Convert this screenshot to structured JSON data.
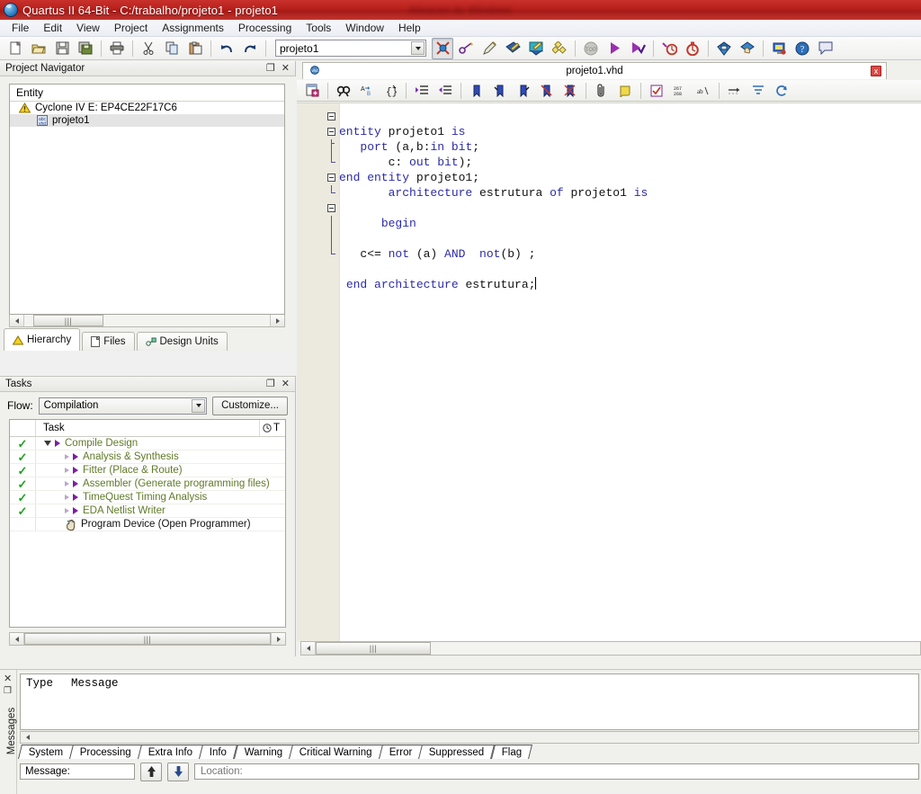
{
  "titlebar": {
    "app_title": "Quartus II 64-Bit - C:/trabalho/projeto1 - projeto1",
    "redacted_text": "Ativacao do Windows",
    "icon": "quartus-logo-icon"
  },
  "menubar": {
    "items": [
      "File",
      "Edit",
      "View",
      "Project",
      "Assignments",
      "Processing",
      "Tools",
      "Window",
      "Help"
    ]
  },
  "toolbar": {
    "project_value": "projeto1",
    "icons_left": [
      "new-file-icon",
      "open-folder-icon",
      "save-icon",
      "save-all-icon",
      "print-icon",
      "cut-icon",
      "copy-icon",
      "paste-icon",
      "undo-icon",
      "redo-icon"
    ],
    "icons_right": [
      "pin-planner-icon",
      "assignment-editor-icon",
      "pencil-icon",
      "compile-all-icon",
      "analysis-synthesis-icon",
      "netlist-viewer-icon",
      "stop-icon",
      "start-compilation-icon",
      "start-analysis-icon",
      "timing-analyzer-icon",
      "timequest-icon",
      "programmer-icon",
      "program-device-icon",
      "rtl-viewer-icon",
      "help-icon",
      "message-icon"
    ]
  },
  "navigator": {
    "title": "Project Navigator",
    "column_header": "Entity",
    "rows": [
      {
        "label": "Cyclone IV E: EP4CE22F17C6",
        "icon": "warning-triangle-icon",
        "indent": 0,
        "selected": false
      },
      {
        "label": "projeto1",
        "icon": "vhdl-file-icon",
        "indent": 1,
        "selected": true
      }
    ],
    "tabs": [
      {
        "label": "Hierarchy",
        "icon": "warning-triangle-icon",
        "active": true
      },
      {
        "label": "Files",
        "icon": "file-icon",
        "active": false
      },
      {
        "label": "Design Units",
        "icon": "design-units-icon",
        "active": false
      }
    ]
  },
  "tasks": {
    "title": "Tasks",
    "flow_label": "Flow:",
    "flow_value": "Compilation",
    "customize_label": "Customize...",
    "columns": [
      "Task",
      "T"
    ],
    "time_icon": "clock-icon",
    "rows": [
      {
        "label": "Compile Design",
        "checked": true,
        "indent": 0,
        "expander": "down",
        "arrow": "solid",
        "dark": false
      },
      {
        "label": "Analysis & Synthesis",
        "checked": true,
        "indent": 1,
        "expander": "right",
        "arrow": "solid",
        "dark": false
      },
      {
        "label": "Fitter (Place & Route)",
        "checked": true,
        "indent": 1,
        "expander": "right",
        "arrow": "solid",
        "dark": false
      },
      {
        "label": "Assembler (Generate programming files)",
        "checked": true,
        "indent": 1,
        "expander": "right",
        "arrow": "solid",
        "dark": false
      },
      {
        "label": "TimeQuest Timing Analysis",
        "checked": true,
        "indent": 1,
        "expander": "right",
        "arrow": "solid",
        "dark": false
      },
      {
        "label": "EDA Netlist Writer",
        "checked": true,
        "indent": 1,
        "expander": "right",
        "arrow": "solid",
        "dark": false
      },
      {
        "label": "Program Device (Open Programmer)",
        "checked": false,
        "indent": 0,
        "expander": "none",
        "arrow": "hand",
        "dark": true
      }
    ]
  },
  "editor": {
    "tab_title": "projeto1.vhd",
    "tab_icon": "vhdl-file-icon",
    "close_label": "x",
    "toolbar_icons": [
      "insert-template-icon",
      "find-icon",
      "find-replace-icon",
      "goto-line-icon",
      "increase-indent-icon",
      "decrease-indent-icon",
      "bookmark-add-icon",
      "bookmark-next-icon",
      "bookmark-prev-icon",
      "bookmark-clear-icon",
      "bookmark-clear-all-icon",
      "attach-icon",
      "comment-icon",
      "spellcheck-icon",
      "line-numbers-icon",
      "word-wrap-icon",
      "tab-arrow-icon",
      "align-icon",
      "reload-icon"
    ],
    "code_lines": [
      {
        "fold": "box",
        "tokens": [
          {
            "t": "entity ",
            "c": "kw"
          },
          {
            "t": "projeto1 ",
            "c": "id"
          },
          {
            "t": "is",
            "c": "kw"
          }
        ]
      },
      {
        "fold": "box",
        "tokens": [
          {
            "t": "   ",
            "c": "id"
          },
          {
            "t": "port",
            "c": "kw"
          },
          {
            "t": " (a,b:",
            "c": "id"
          },
          {
            "t": "in bit",
            "c": "kw"
          },
          {
            "t": ";",
            "c": "id"
          }
        ]
      },
      {
        "fold": "tee",
        "tokens": [
          {
            "t": "       c: ",
            "c": "id"
          },
          {
            "t": "out bit",
            "c": "kw"
          },
          {
            "t": ");",
            "c": "id"
          }
        ]
      },
      {
        "fold": "end",
        "tokens": [
          {
            "t": "end entity ",
            "c": "kw"
          },
          {
            "t": "projeto1;",
            "c": "id"
          }
        ]
      },
      {
        "fold": "box",
        "tokens": [
          {
            "t": "       ",
            "c": "id"
          },
          {
            "t": "architecture",
            "c": "kw"
          },
          {
            "t": " estrutura ",
            "c": "id"
          },
          {
            "t": "of",
            "c": "kw"
          },
          {
            "t": " projeto1 ",
            "c": "id"
          },
          {
            "t": "is",
            "c": "kw"
          }
        ]
      },
      {
        "fold": "end",
        "tokens": [
          {
            "t": "",
            "c": "id"
          }
        ]
      },
      {
        "fold": "box",
        "tokens": [
          {
            "t": "      ",
            "c": "id"
          },
          {
            "t": "begin",
            "c": "kw"
          }
        ]
      },
      {
        "fold": "line",
        "tokens": [
          {
            "t": "",
            "c": "id"
          }
        ]
      },
      {
        "fold": "line",
        "tokens": [
          {
            "t": "   c<= ",
            "c": "id"
          },
          {
            "t": "not",
            "c": "kw"
          },
          {
            "t": " (a) ",
            "c": "id"
          },
          {
            "t": "AND",
            "c": "kw"
          },
          {
            "t": "  ",
            "c": "id"
          },
          {
            "t": "not",
            "c": "kw"
          },
          {
            "t": "(b) ;",
            "c": "id"
          }
        ]
      },
      {
        "fold": "end",
        "tokens": [
          {
            "t": "",
            "c": "id"
          }
        ]
      },
      {
        "fold": "none",
        "tokens": [
          {
            "t": " ",
            "c": "id"
          },
          {
            "t": "end architecture",
            "c": "kw"
          },
          {
            "t": " estrutura;",
            "c": "id"
          }
        ],
        "caret": true
      }
    ]
  },
  "messages": {
    "panel_label": "Messages",
    "close_icon": "close-icon",
    "dock_icon": "dock-icon",
    "columns": [
      "Type",
      "Message"
    ],
    "tabs": [
      {
        "label": "System",
        "active": true
      },
      {
        "label": "Processing",
        "active": false
      },
      {
        "label": "Extra Info",
        "active": false
      },
      {
        "label": "Info",
        "active": false
      },
      {
        "label": "Warning",
        "active": false
      },
      {
        "label": "Critical Warning",
        "active": false
      },
      {
        "label": "Error",
        "active": false
      },
      {
        "label": "Suppressed",
        "active": false
      },
      {
        "label": "Flag",
        "active": false
      }
    ],
    "message_label": "Message:",
    "message_value": "",
    "location_label": "Location:",
    "up_icon": "arrow-up-icon",
    "down_icon": "arrow-down-icon"
  },
  "colors": {
    "title_red": "#b8201c",
    "keyword_blue": "#2b2ba8",
    "task_green": "#5f7a28",
    "check_green": "#21a021",
    "accent_purple": "#7b1fa2"
  }
}
